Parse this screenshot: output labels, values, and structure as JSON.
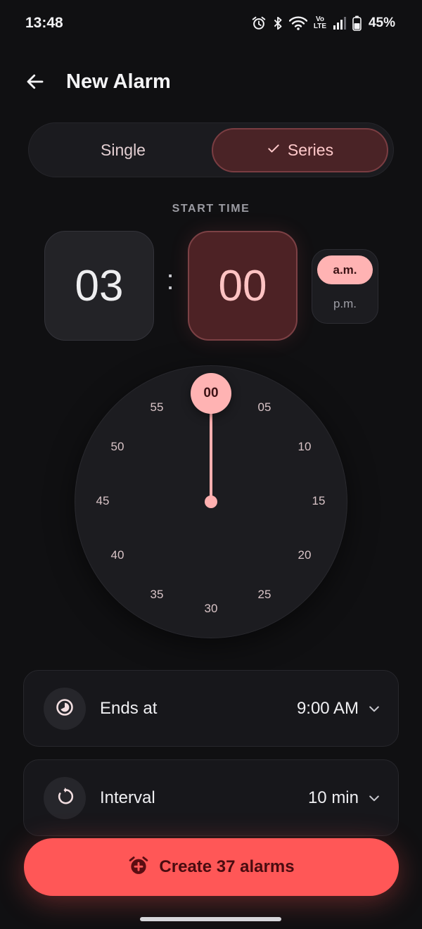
{
  "status_bar": {
    "time": "13:48",
    "network_label_top": "Vo",
    "network_label_bottom": "LTE",
    "battery_percent": "45%",
    "icons": [
      "alarm-icon",
      "bluetooth-icon",
      "wifi-icon",
      "volte-icon",
      "signal-icon",
      "battery-icon"
    ]
  },
  "header": {
    "back_icon": "arrow-left-icon",
    "title": "New Alarm"
  },
  "mode_selector": {
    "options": [
      "Single",
      "Series"
    ],
    "selected": "Series",
    "check_icon": "check-icon"
  },
  "start_time": {
    "label": "START TIME",
    "hour": "03",
    "separator": ":",
    "minute": "00",
    "period_options": [
      "a.m.",
      "p.m."
    ],
    "period_selected": "a.m."
  },
  "dial": {
    "selected": "00",
    "numbers": [
      "05",
      "10",
      "15",
      "20",
      "25",
      "30",
      "35",
      "40",
      "45",
      "50",
      "55"
    ]
  },
  "settings": {
    "ends_at": {
      "label": "Ends at",
      "value": "9:00 AM",
      "icon": "timelapse-icon"
    },
    "interval": {
      "label": "Interval",
      "value": "10 min",
      "icon": "restart-icon"
    }
  },
  "primary_action": {
    "label": "Create 37 alarms",
    "icon": "alarm-add-icon"
  },
  "colors": {
    "background": "#101012",
    "accent": "#ff5757",
    "accent_soft": "#ffb3b3",
    "selected_container": "#4d2225"
  }
}
